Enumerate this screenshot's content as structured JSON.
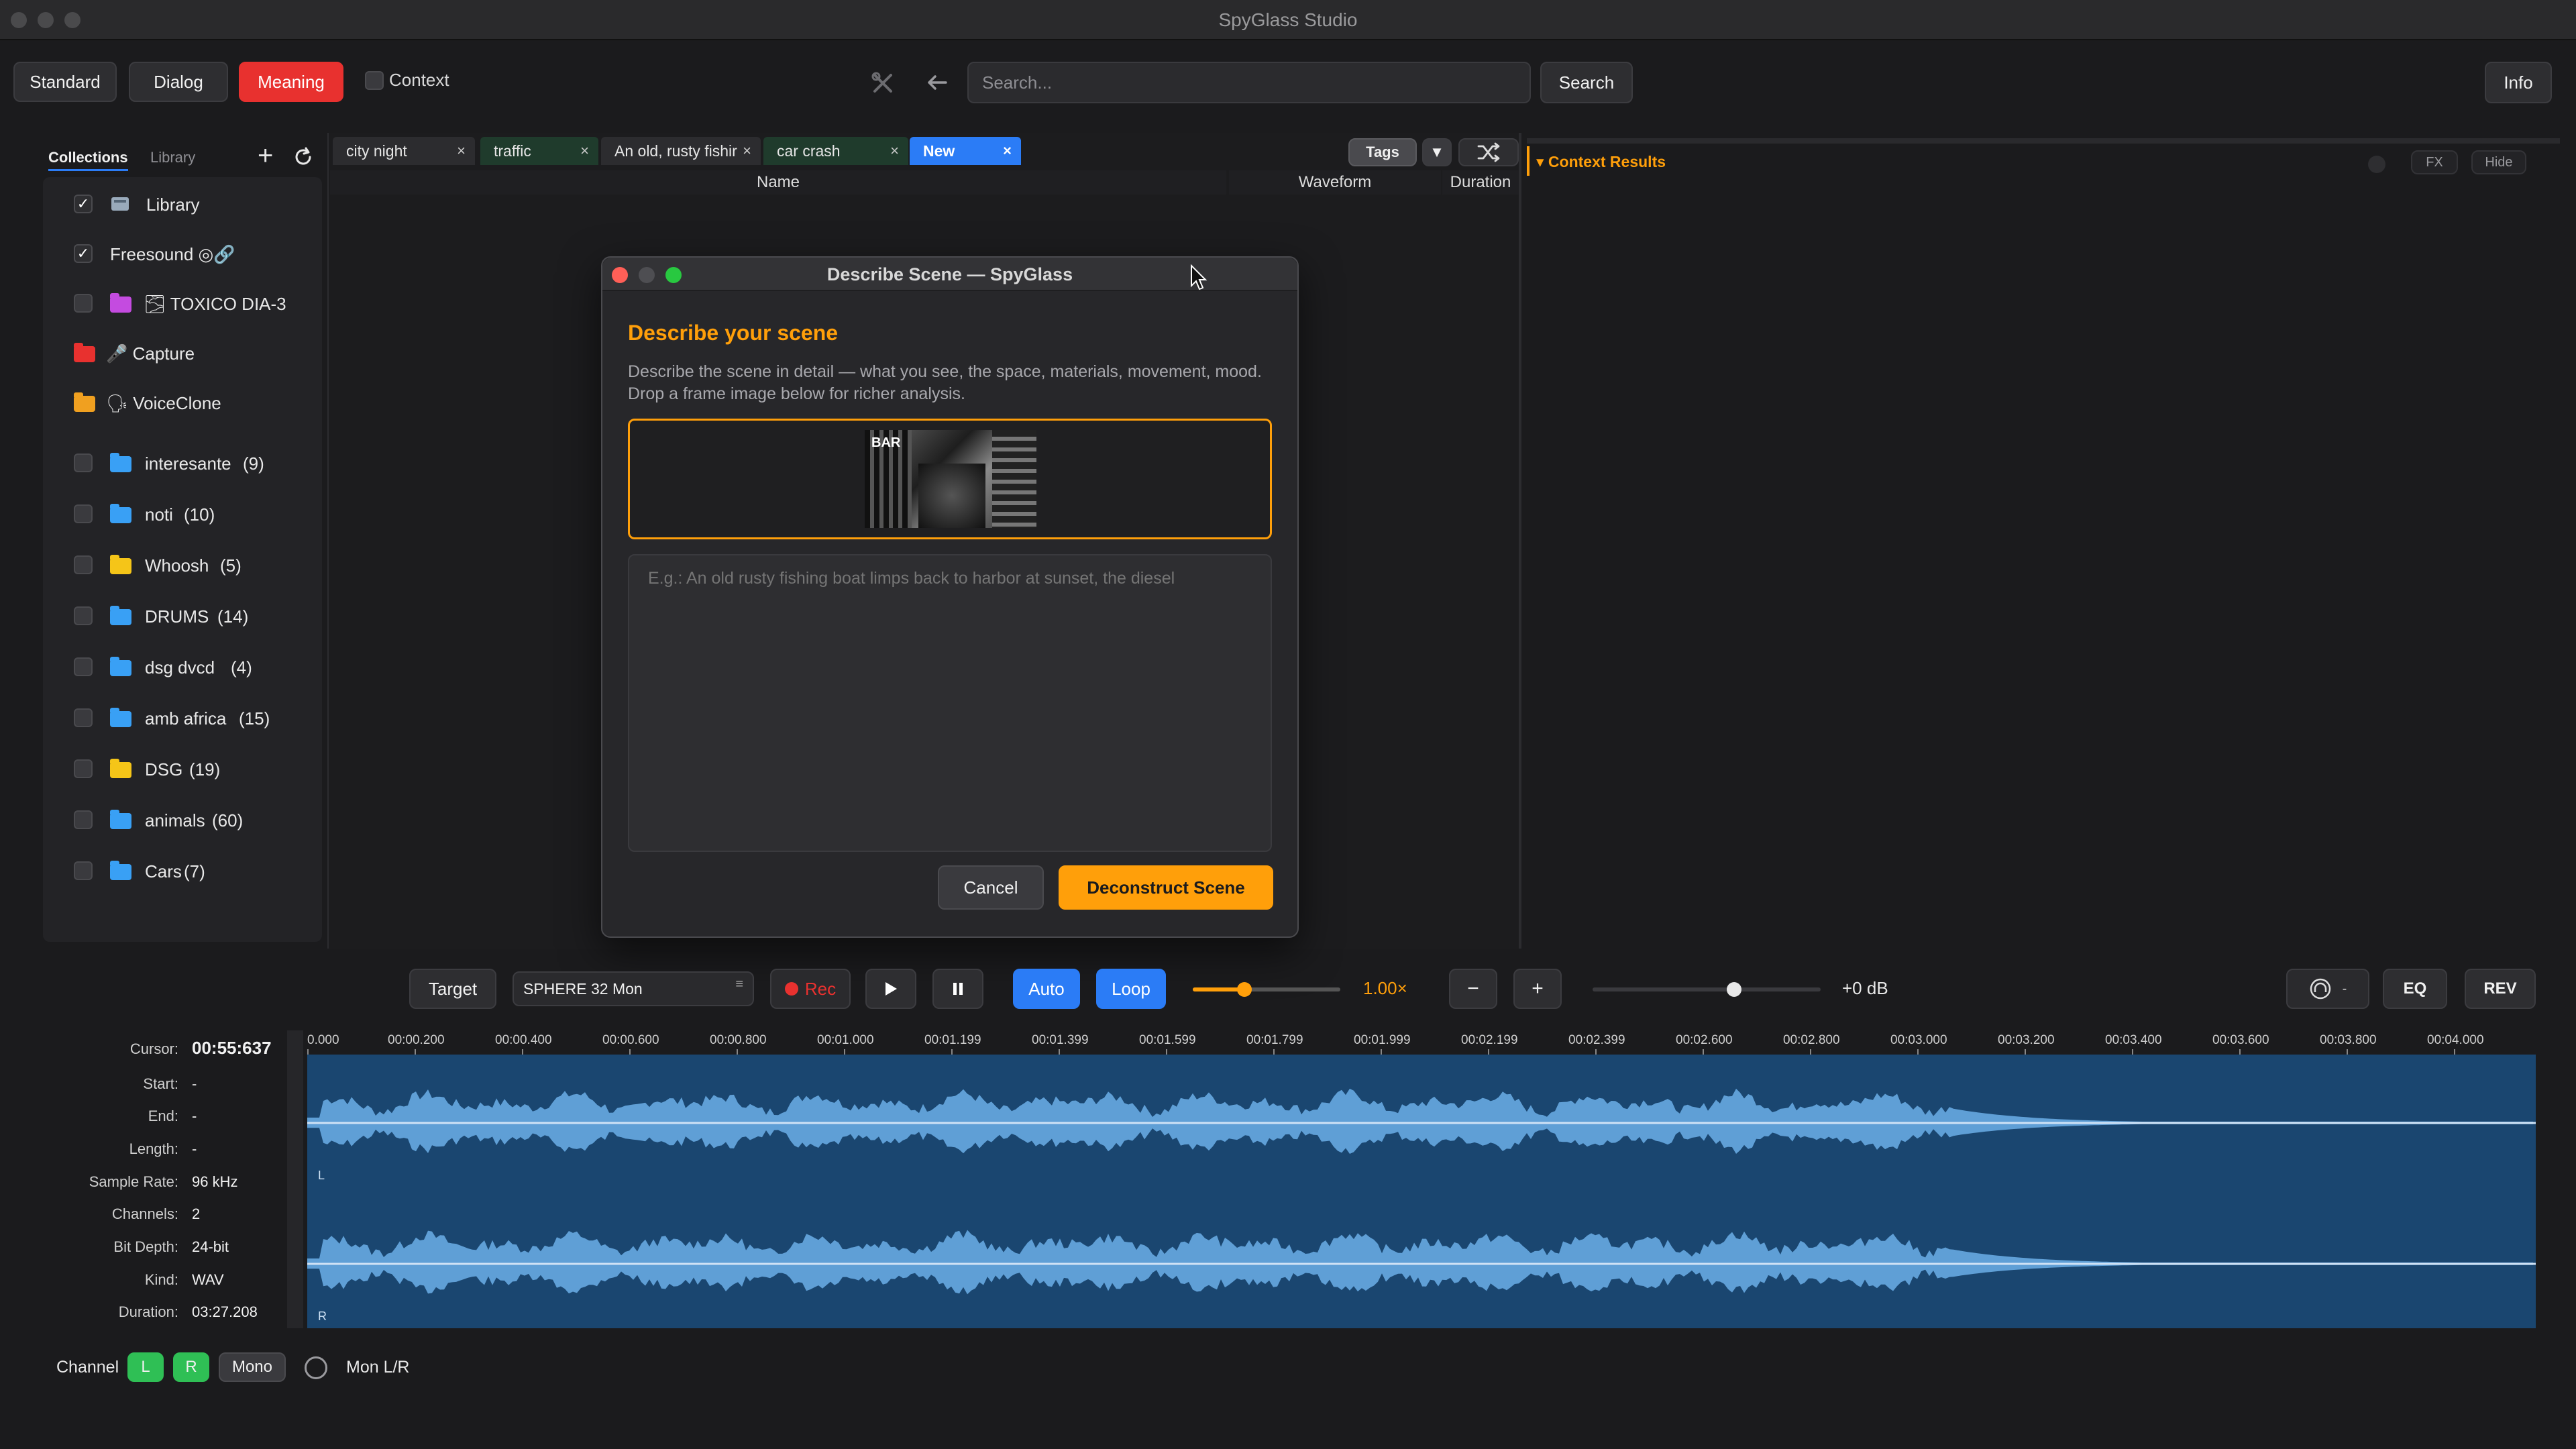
{
  "app": {
    "title": "SpyGlass Studio"
  },
  "toolbar": {
    "modes": [
      "Standard",
      "Dialog",
      "Meaning"
    ],
    "active_mode": "Meaning",
    "context_label": "Context",
    "search_placeholder": "Search...",
    "search_button": "Search",
    "info_button": "Info"
  },
  "sidebar": {
    "tabs": [
      "Collections",
      "Library"
    ],
    "items": [
      {
        "label": "Library",
        "checked": true,
        "icon": "library-icon"
      },
      {
        "label": "Freesound ◎🔗",
        "checked": true,
        "icon": "none"
      },
      {
        "label": "🌫 TOXICO DIA-3",
        "checked": false,
        "folder_color": "#c44be0"
      },
      {
        "label": "🎤 Capture",
        "folder_color": "#e8312f"
      },
      {
        "label": "🗣 VoiceClone",
        "folder_color": "#f0a020"
      },
      {
        "label": "interesante",
        "count": "(9)",
        "checked": false,
        "folder_color": "#39a0f5"
      },
      {
        "label": "noti",
        "count": "(10)",
        "checked": false,
        "folder_color": "#39a0f5"
      },
      {
        "label": "Whoosh",
        "count": "(5)",
        "checked": false,
        "folder_color": "#f5c518"
      },
      {
        "label": "DRUMS",
        "count": "(14)",
        "checked": false,
        "folder_color": "#39a0f5"
      },
      {
        "label": "dsg dvcd",
        "count": "(4)",
        "checked": false,
        "folder_color": "#39a0f5"
      },
      {
        "label": "amb africa",
        "count": "(15)",
        "checked": false,
        "folder_color": "#39a0f5"
      },
      {
        "label": "DSG",
        "count": "(19)",
        "checked": false,
        "folder_color": "#f5c518"
      },
      {
        "label": "animals",
        "count": "(60)",
        "checked": false,
        "folder_color": "#39a0f5"
      },
      {
        "label": "Cars",
        "count": "(7)",
        "checked": false,
        "folder_color": "#39a0f5"
      }
    ]
  },
  "tabs": [
    {
      "label": "city night",
      "active": false
    },
    {
      "label": "traffic",
      "active": false
    },
    {
      "label": "An old, rusty fishir",
      "active": false
    },
    {
      "label": "car crash",
      "active": false
    },
    {
      "label": "New",
      "active": true
    }
  ],
  "columns": {
    "name": "Name",
    "waveform": "Waveform",
    "duration": "Duration"
  },
  "tags_button": "Tags",
  "context_panel": {
    "title": "▾ Context Results",
    "fx": "FX",
    "hide": "Hide"
  },
  "dialog": {
    "title": "Describe Scene — SpyGlass",
    "heading": "Describe your scene",
    "description": "Describe the scene in detail — what you see, the space, materials, movement, mood. Drop a frame image below for richer analysis.",
    "image_sign": "BAR",
    "textarea_placeholder": "E.g.: An old rusty fishing boat limps back to harbor at sunset, the diesel",
    "cancel": "Cancel",
    "confirm": "Deconstruct Scene"
  },
  "transport": {
    "target": "Target",
    "device": "SPHERE 32 Mon",
    "rec": "Rec",
    "auto": "Auto",
    "loop": "Loop",
    "speed": "1.00×",
    "minus": "−",
    "plus": "+",
    "gain": "+0 dB",
    "eq": "EQ",
    "rev": "REV",
    "speed_fraction": 0.35,
    "gain_fraction": 0.62
  },
  "file_info": [
    {
      "label": "Cursor:",
      "value": "00:55:637"
    },
    {
      "label": "Start:",
      "value": "-"
    },
    {
      "label": "End:",
      "value": "-"
    },
    {
      "label": "Length:",
      "value": "-"
    },
    {
      "label": "Sample Rate:",
      "value": "96 kHz"
    },
    {
      "label": "Channels:",
      "value": "2"
    },
    {
      "label": "Bit Depth:",
      "value": "24-bit"
    },
    {
      "label": "Kind:",
      "value": "WAV"
    },
    {
      "label": "Duration:",
      "value": "03:27.208"
    }
  ],
  "ruler_ticks": [
    "0.000",
    "00:00.200",
    "00:00.400",
    "00:00.600",
    "00:00.800",
    "00:01.000",
    "00:01.199",
    "00:01.399",
    "00:01.599",
    "00:01.799",
    "00:01.999",
    "00:02.199",
    "00:02.399",
    "00:02.600",
    "00:02.800",
    "00:03.000",
    "00:03.200",
    "00:03.400",
    "00:03.600",
    "00:03.800",
    "00:04.000"
  ],
  "channel_labels": {
    "left": "L",
    "right": "R"
  },
  "channel_bar": {
    "label": "Channel",
    "l": "L",
    "r": "R",
    "mono": "Mono",
    "mon": "Mon L/R"
  },
  "colors": {
    "accent_orange": "#ff9f0a",
    "accent_red": "#e8312f",
    "accent_blue": "#2b7cf6",
    "wave": "#5f9fd6",
    "wave_bg": "#1a4670",
    "green": "#2fbf55"
  }
}
